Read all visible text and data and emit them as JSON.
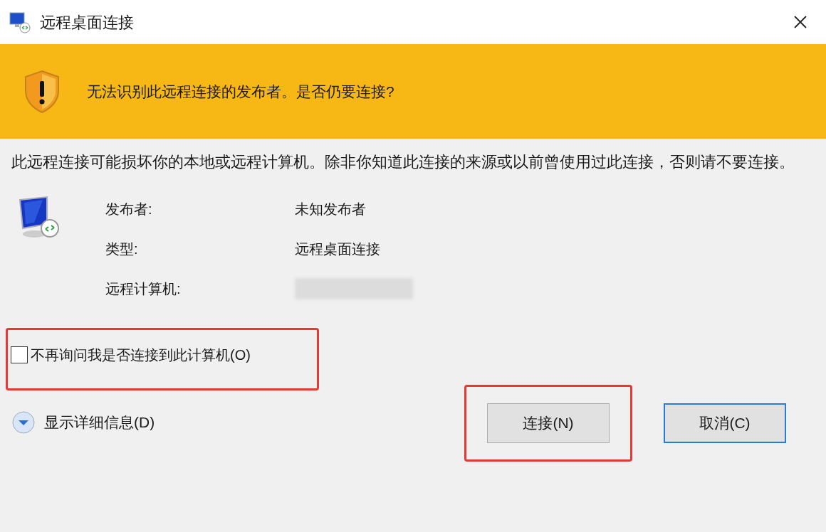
{
  "window": {
    "title": "远程桌面连接"
  },
  "banner": {
    "message": "无法识别此远程连接的发布者。是否仍要连接?"
  },
  "warning": "此远程连接可能损坏你的本地或远程计算机。除非你知道此连接的来源或以前曾使用过此连接，否则请不要连接。",
  "details": [
    {
      "label": "发布者:",
      "value": "未知发布者"
    },
    {
      "label": "类型:",
      "value": "远程桌面连接"
    },
    {
      "label": "远程计算机:",
      "redacted": true
    }
  ],
  "dont_ask": {
    "label": "不再询问我是否连接到此计算机(O)",
    "checked": false,
    "highlighted": true
  },
  "show_details": {
    "label": "显示详细信息(D)",
    "expanded": false
  },
  "buttons": [
    {
      "label": "连接(N)",
      "default": false,
      "highlighted": true
    },
    {
      "label": "取消(C)",
      "default": true,
      "highlighted": false
    }
  ]
}
